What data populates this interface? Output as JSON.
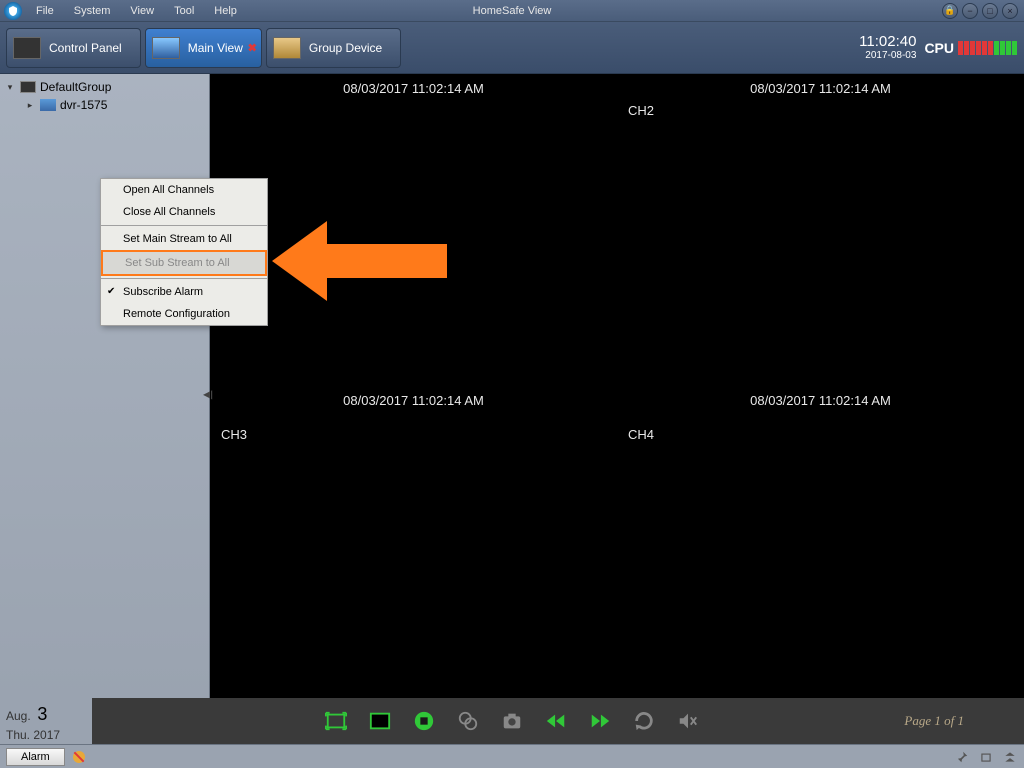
{
  "app": {
    "title": "HomeSafe View"
  },
  "menu": [
    "File",
    "System",
    "View",
    "Tool",
    "Help"
  ],
  "tabs": [
    {
      "label": "Control Panel",
      "closable": false
    },
    {
      "label": "Main View",
      "closable": true,
      "active": true
    },
    {
      "label": "Group Device",
      "closable": false
    }
  ],
  "status": {
    "time": "11:02:40",
    "date": "2017-08-03",
    "cpu_label": "CPU"
  },
  "tree": {
    "group": "DefaultGroup",
    "device": "dvr-1575"
  },
  "context_menu": {
    "items": [
      {
        "label": "Open All Channels"
      },
      {
        "label": "Close All Channels"
      },
      {
        "sep": true
      },
      {
        "label": "Set Main Stream to All"
      },
      {
        "label": "Set Sub Stream to All",
        "highlighted": true
      },
      {
        "sep": true
      },
      {
        "label": "Subscribe Alarm",
        "checked": true
      },
      {
        "label": "Remote Configuration"
      }
    ]
  },
  "cells": [
    {
      "timestamp": "08/03/2017 11:02:14 AM",
      "channel": ""
    },
    {
      "timestamp": "08/03/2017 11:02:14 AM",
      "channel": "CH2"
    },
    {
      "timestamp": "08/03/2017 11:02:14 AM",
      "channel": "CH3"
    },
    {
      "timestamp": "08/03/2017 11:02:14 AM",
      "channel": "CH4"
    }
  ],
  "toolbar": {
    "date_month": "Aug.",
    "date_day": "3",
    "date_weekday": "Thu.",
    "date_year": "2017",
    "page_info": "Page 1 of 1"
  },
  "statusbar": {
    "alarm": "Alarm"
  }
}
